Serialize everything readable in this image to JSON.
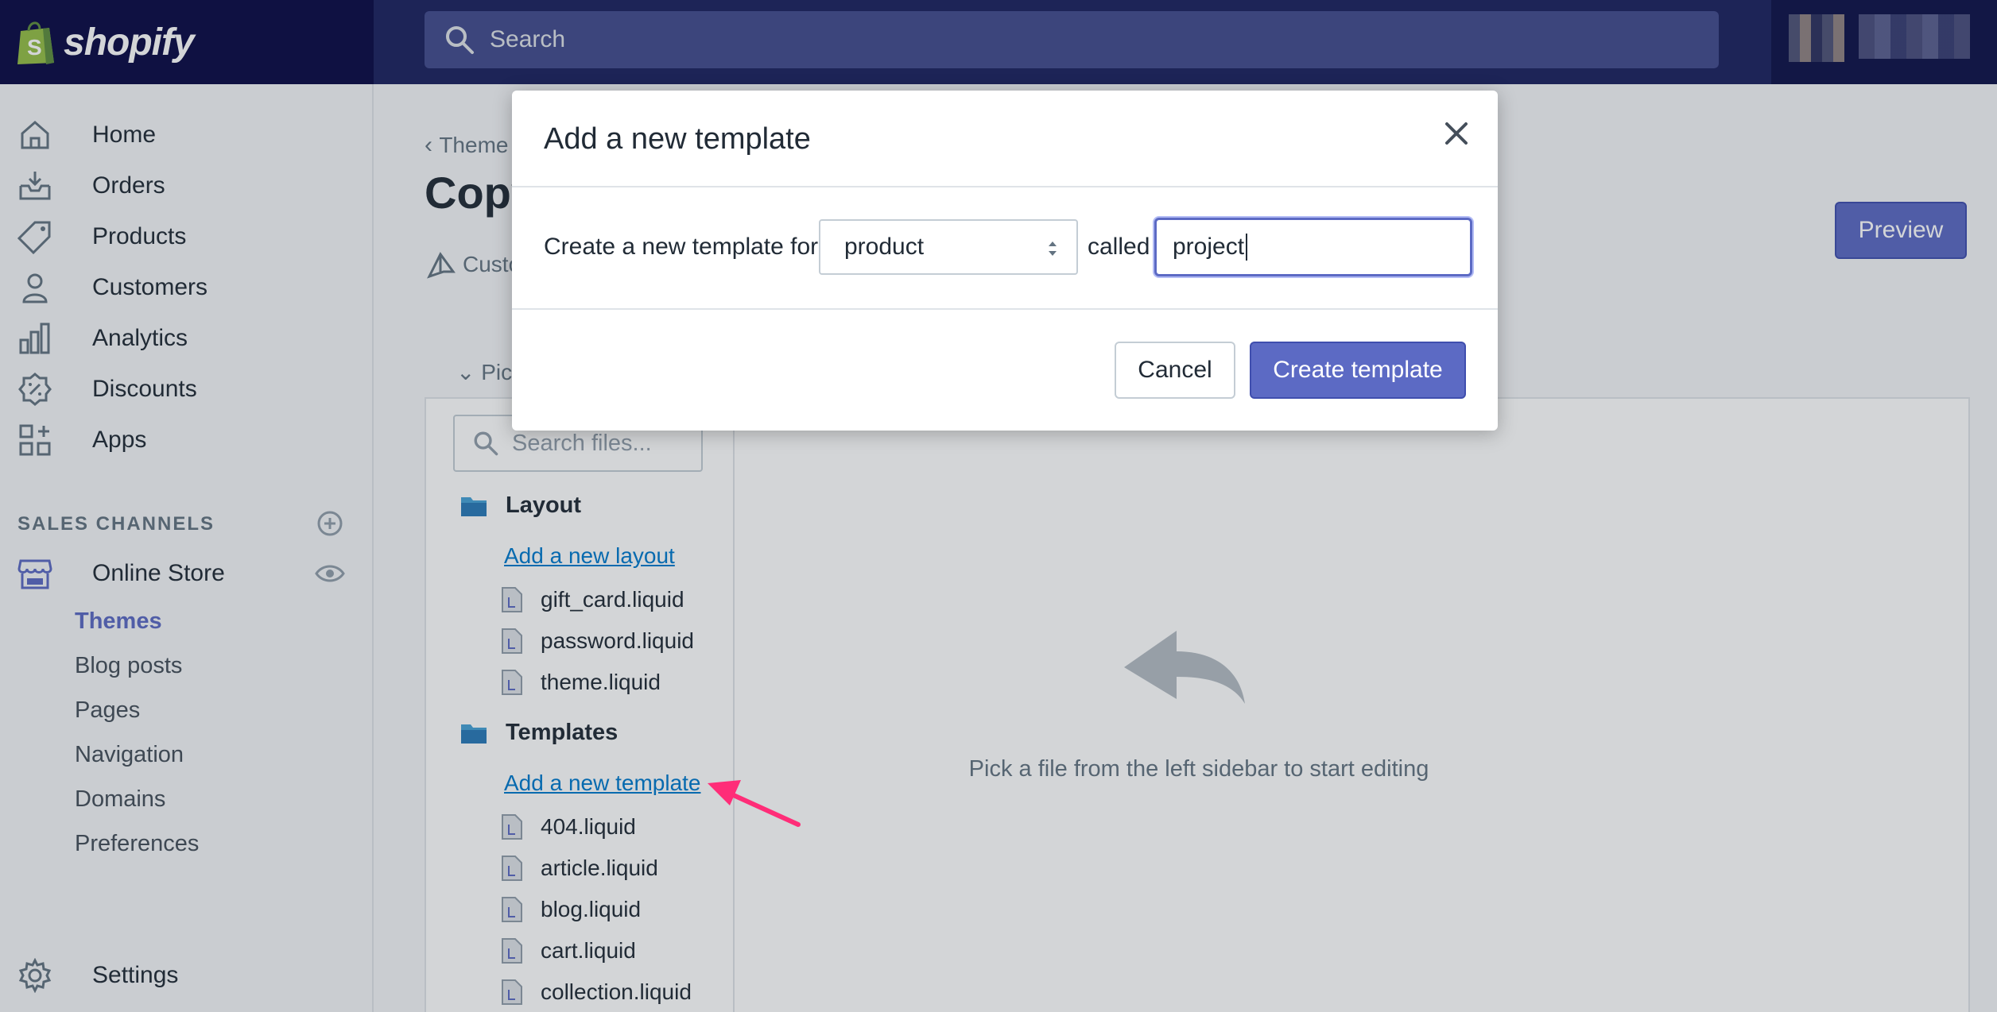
{
  "brand": {
    "name": "shopify"
  },
  "search": {
    "placeholder": "Search"
  },
  "sidebar": {
    "items": [
      {
        "label": "Home",
        "icon": "home-icon"
      },
      {
        "label": "Orders",
        "icon": "orders-icon"
      },
      {
        "label": "Products",
        "icon": "tag-icon"
      },
      {
        "label": "Customers",
        "icon": "person-icon"
      },
      {
        "label": "Analytics",
        "icon": "bar-chart-icon"
      },
      {
        "label": "Discounts",
        "icon": "discount-icon"
      },
      {
        "label": "Apps",
        "icon": "apps-icon"
      }
    ],
    "sales_channels_heading": "SALES CHANNELS",
    "online_store": "Online Store",
    "sub_items": [
      "Themes",
      "Blog posts",
      "Pages",
      "Navigation",
      "Domains",
      "Preferences"
    ],
    "settings": "Settings"
  },
  "main": {
    "breadcrumb": "Theme",
    "title": "Copy",
    "customize": "Custo",
    "preview_label": "Preview",
    "pick_toggle": "Pic"
  },
  "files": {
    "search_placeholder": "Search files...",
    "layout": {
      "label": "Layout",
      "add_link": "Add a new layout",
      "files": [
        "gift_card.liquid",
        "password.liquid",
        "theme.liquid"
      ]
    },
    "templates": {
      "label": "Templates",
      "add_link": "Add a new template",
      "files": [
        "404.liquid",
        "article.liquid",
        "blog.liquid",
        "cart.liquid",
        "collection.liquid"
      ]
    }
  },
  "editor": {
    "empty_text": "Pick a file from the left sidebar to start editing"
  },
  "modal": {
    "title": "Add a new template",
    "row_label": "Create a new template for",
    "select_value": "product",
    "called_label": "called",
    "name_value": "project",
    "cancel_label": "Cancel",
    "create_label": "Create template"
  },
  "colors": {
    "accent": "#5c6ac4",
    "topbar": "#1c2260",
    "brand_bg": "#0b0b45",
    "link": "#007ace",
    "annotation": "#ff2d78"
  }
}
